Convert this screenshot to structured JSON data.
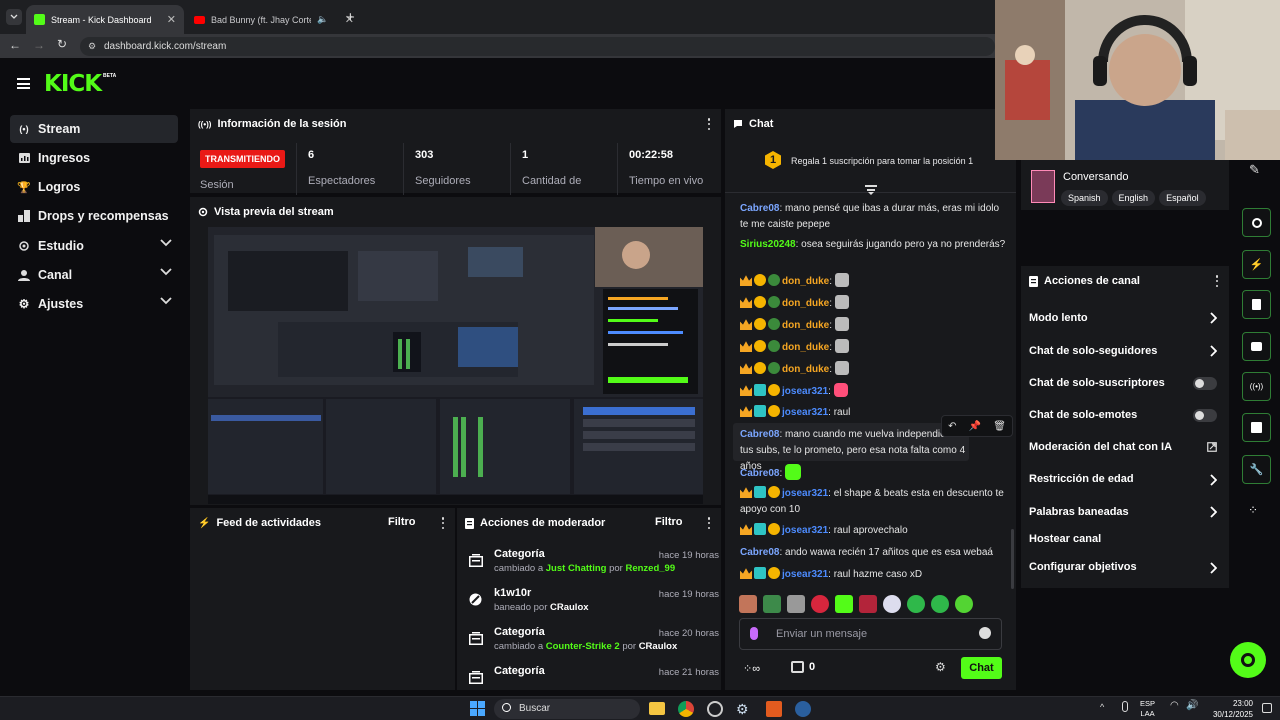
{
  "browser": {
    "tabs": [
      {
        "title": "Stream - Kick Dashboard"
      },
      {
        "title": "Bad Bunny (ft. Jhay Cortez)"
      }
    ],
    "url": "dashboard.kick.com/stream"
  },
  "header": {
    "logo": "KICK",
    "logo_badge": "BETA"
  },
  "sidebar": {
    "items": [
      {
        "label": "Stream"
      },
      {
        "label": "Ingresos"
      },
      {
        "label": "Logros"
      },
      {
        "label": "Drops y recompensas"
      },
      {
        "label": "Estudio"
      },
      {
        "label": "Canal"
      },
      {
        "label": "Ajustes"
      }
    ]
  },
  "session": {
    "title": "Información de la sesión",
    "status_badge": "TRANSMITIENDO",
    "status_label": "Sesión",
    "stats": [
      {
        "value": "6",
        "label": "Espectadores"
      },
      {
        "value": "303",
        "label": "Seguidores"
      },
      {
        "value": "1",
        "label": "Cantidad de"
      },
      {
        "value": "00:22:58",
        "label": "Tiempo en vivo"
      }
    ]
  },
  "preview": {
    "title": "Vista previa del stream"
  },
  "activity": {
    "title": "Feed de actividades",
    "filter": "Filtro"
  },
  "moderator": {
    "title": "Acciones de moderador",
    "filter": "Filtro",
    "items": [
      {
        "title": "Categoría",
        "pre": "cambiado a",
        "target": "Just Chatting",
        "by": "por",
        "user": "Renzed_99",
        "time": "hace 19 horas"
      },
      {
        "title": "k1w10r",
        "pre": "baneado",
        "target": "",
        "by": "por",
        "user": "CRaulox",
        "time": "hace 19 horas"
      },
      {
        "title": "Categoría",
        "pre": "cambiado a",
        "target": "Counter-Strike 2",
        "by": "por",
        "user": "CRaulox",
        "time": "hace 20 horas"
      },
      {
        "title": "Categoría",
        "pre": "",
        "target": "",
        "by": "",
        "user": "",
        "time": "hace 21 horas"
      }
    ]
  },
  "chat": {
    "title": "Chat",
    "gift_rank": "1",
    "gift_text": "Regala 1 suscripción para tomar la posición 1",
    "messages": [
      {
        "user": "Cabre08",
        "color": "#7ba6ff",
        "text": "mano pensé que ibas a durar más, eras mi idolo te me caiste pepepe"
      },
      {
        "user": "Sirius20248",
        "color": "#53fc18",
        "text": "osea seguirás jugando pero ya no prenderás?"
      },
      {
        "user": "don_duke",
        "color": "#f5a623",
        "text": ""
      },
      {
        "user": "don_duke",
        "color": "#f5a623",
        "text": ""
      },
      {
        "user": "don_duke",
        "color": "#f5a623",
        "text": ""
      },
      {
        "user": "don_duke",
        "color": "#f5a623",
        "text": ""
      },
      {
        "user": "don_duke",
        "color": "#f5a623",
        "text": ""
      },
      {
        "user": "josear321",
        "color": "#4d8cff",
        "text": ""
      },
      {
        "user": "josear321",
        "color": "#4d8cff",
        "text": "raul"
      },
      {
        "user": "Cabre08",
        "color": "#7ba6ff",
        "text": "mano cuando me vuelva independiente tus subs, te lo prometo, pero esa nota falta como 4 años"
      },
      {
        "user": "Cabre08",
        "color": "#7ba6ff",
        "text": ""
      },
      {
        "user": "josear321",
        "color": "#4d8cff",
        "text": "el shape & beats esta en descuento te apoyo con 10"
      },
      {
        "user": "josear321",
        "color": "#4d8cff",
        "text": "raul aprovechalo"
      },
      {
        "user": "Cabre08",
        "color": "#7ba6ff",
        "text": "ando wawa recién 17 añitos que es esa webaá"
      },
      {
        "user": "josear321",
        "color": "#4d8cff",
        "text": "raul hazme caso xD"
      }
    ],
    "input_placeholder": "Enviar un mensaje",
    "points": "0",
    "send_label": "Chat"
  },
  "profile": {
    "activity": "Conversando",
    "languages": [
      "Spanish",
      "English",
      "Español"
    ]
  },
  "channel_actions": {
    "title": "Acciones de canal",
    "items": [
      {
        "label": "Modo lento",
        "control": "arrow"
      },
      {
        "label": "Chat de solo-seguidores",
        "control": "arrow"
      },
      {
        "label": "Chat de solo-suscriptores",
        "control": "toggle"
      },
      {
        "label": "Chat de solo-emotes",
        "control": "toggle"
      },
      {
        "label": "Moderación del chat con IA",
        "control": "external"
      },
      {
        "label": "Restricción de edad",
        "control": "arrow"
      },
      {
        "label": "Palabras baneadas",
        "control": "arrow"
      },
      {
        "label": "Hostear canal",
        "control": "none"
      },
      {
        "label": "Configurar objetivos",
        "control": "arrow"
      }
    ]
  },
  "taskbar": {
    "search": "Buscar",
    "lang_top": "ESP",
    "lang_bottom": "LAA",
    "time": "23:00",
    "date": "30/12/2025"
  },
  "colors": {
    "accent": "#53fc18",
    "live_red": "#e91916",
    "panel": "#18191c",
    "bg": "#0c0c0f"
  }
}
